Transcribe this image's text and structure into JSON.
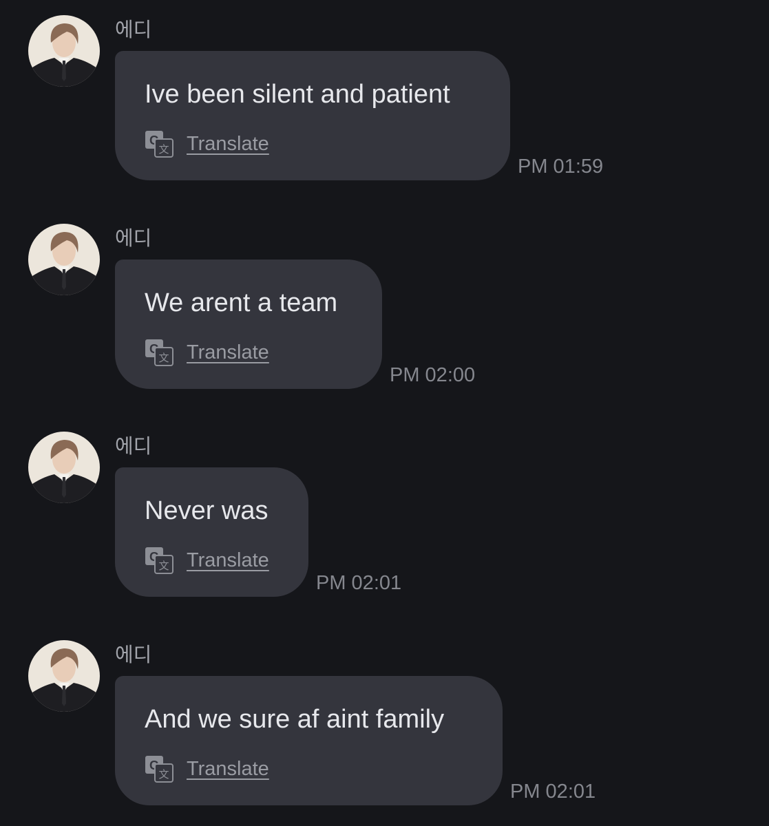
{
  "messages": [
    {
      "sender": "에디",
      "text": "Ive been silent and patient",
      "translate_label": "Translate",
      "time": "PM 01:59",
      "avatar_icon": "profile-photo"
    },
    {
      "sender": "에디",
      "text": "We arent a team",
      "translate_label": "Translate",
      "time": "PM 02:00",
      "avatar_icon": "profile-photo"
    },
    {
      "sender": "에디",
      "text": "Never was",
      "translate_label": "Translate",
      "time": "PM 02:01",
      "avatar_icon": "profile-photo"
    },
    {
      "sender": "에디",
      "text": "And we sure af aint family",
      "translate_label": "Translate",
      "time": "PM 02:01",
      "avatar_icon": "profile-photo"
    }
  ],
  "theme": {
    "background": "#15161a",
    "bubble": "#34353d",
    "text": "#e7e8ec",
    "muted": "#85878e"
  }
}
